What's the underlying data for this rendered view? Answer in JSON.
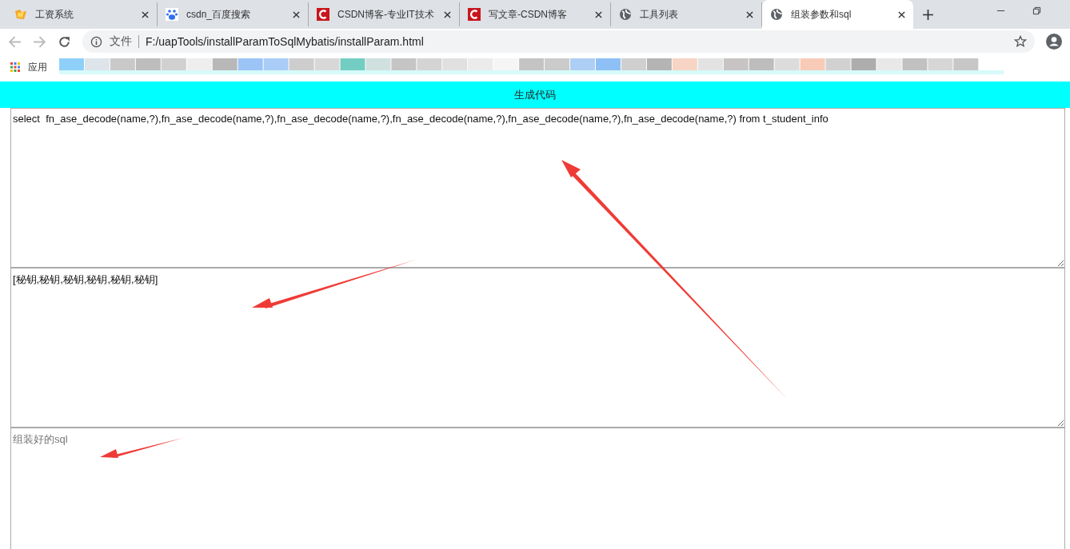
{
  "tabs": [
    {
      "title": "工资系统",
      "kind": "folder",
      "selected": false
    },
    {
      "title": "csdn_百度搜索",
      "kind": "paw",
      "selected": false
    },
    {
      "title": "CSDN博客-专业IT技术",
      "kind": "csdn",
      "selected": false
    },
    {
      "title": "写文章-CSDN博客",
      "kind": "csdn",
      "selected": false
    },
    {
      "title": "工具列表",
      "kind": "globe",
      "selected": false
    },
    {
      "title": "组装参数和sql",
      "kind": "globe",
      "selected": true
    }
  ],
  "address": {
    "scheme": "文件",
    "url": "F:/uapTools/installParamToSqlMybatis/installParam.html"
  },
  "bookmarks": {
    "apps_label": "应用"
  },
  "generate_button": "生成代码",
  "fields": [
    {
      "value": "select  fn_ase_decode(name,?),fn_ase_decode(name,?),fn_ase_decode(name,?),fn_ase_decode(name,?),fn_ase_decode(name,?),fn_ase_decode(name,?) from t_student_info"
    },
    {
      "value": "[秘钥,秘钥,秘钥,秘钥,秘钥,秘钥]"
    },
    {
      "placeholder": "组装好的sql"
    }
  ]
}
